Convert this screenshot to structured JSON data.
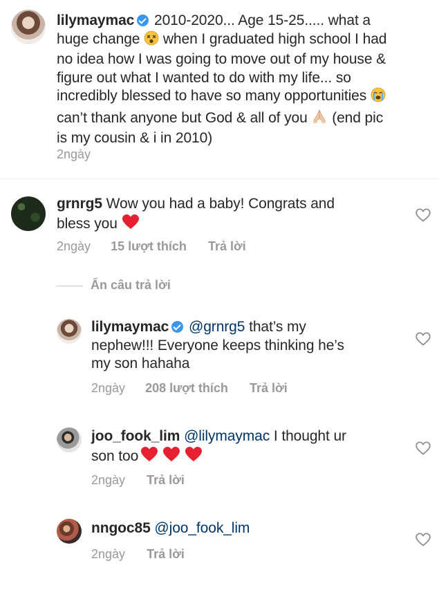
{
  "caption": {
    "username": "lilymaymac",
    "text_part1": "2010-2020... Age 15-25..... what a",
    "text_line2_start": "huge change",
    "text_line2_end": "when I graduated high school I had",
    "text_line3": "no idea how I was going to move out of my house &",
    "text_line4": "figure out what I wanted to do with my life... so",
    "text_line5": "incredibly blessed to have so many opportunities",
    "text_line6_start": "can’t thank anyone but God & all of you",
    "text_line6_end": "(end pic",
    "text_line7": "is my cousin & i in 2010)",
    "time": "2ngày"
  },
  "comments": [
    {
      "username": "grnrg5",
      "text_line1": "Wow you had a baby! Congrats and",
      "text_line2": "bless you",
      "time": "2ngày",
      "likes": "15 lượt thích",
      "reply": "Trả lời"
    }
  ],
  "hide_replies": "Ẩn câu trả lời",
  "replies": [
    {
      "username": "lilymaymac",
      "mention": "@grnrg5",
      "text_line1": "that’s my",
      "text_line2": "nephew!!! Everyone keeps thinking he’s",
      "text_line3": "my son hahaha",
      "time": "2ngày",
      "likes": "208 lượt thích",
      "reply": "Trả lời"
    },
    {
      "username": "joo_fook_lim",
      "mention": "@lilymaymac",
      "text_line1": "I thought ur",
      "text_line2": "son too",
      "time": "2ngày",
      "reply": "Trả lời"
    },
    {
      "username": "nngoc85",
      "mention": "@joo_fook_lim",
      "time": "2ngày",
      "reply": "Trả lời"
    }
  ],
  "icons": {
    "verified": "verified-badge-icon",
    "like": "heart-outline-icon",
    "colors": {
      "verified": "#3897f0",
      "mention": "#003569",
      "heart": "#ed4956",
      "meta": "#999999"
    }
  }
}
